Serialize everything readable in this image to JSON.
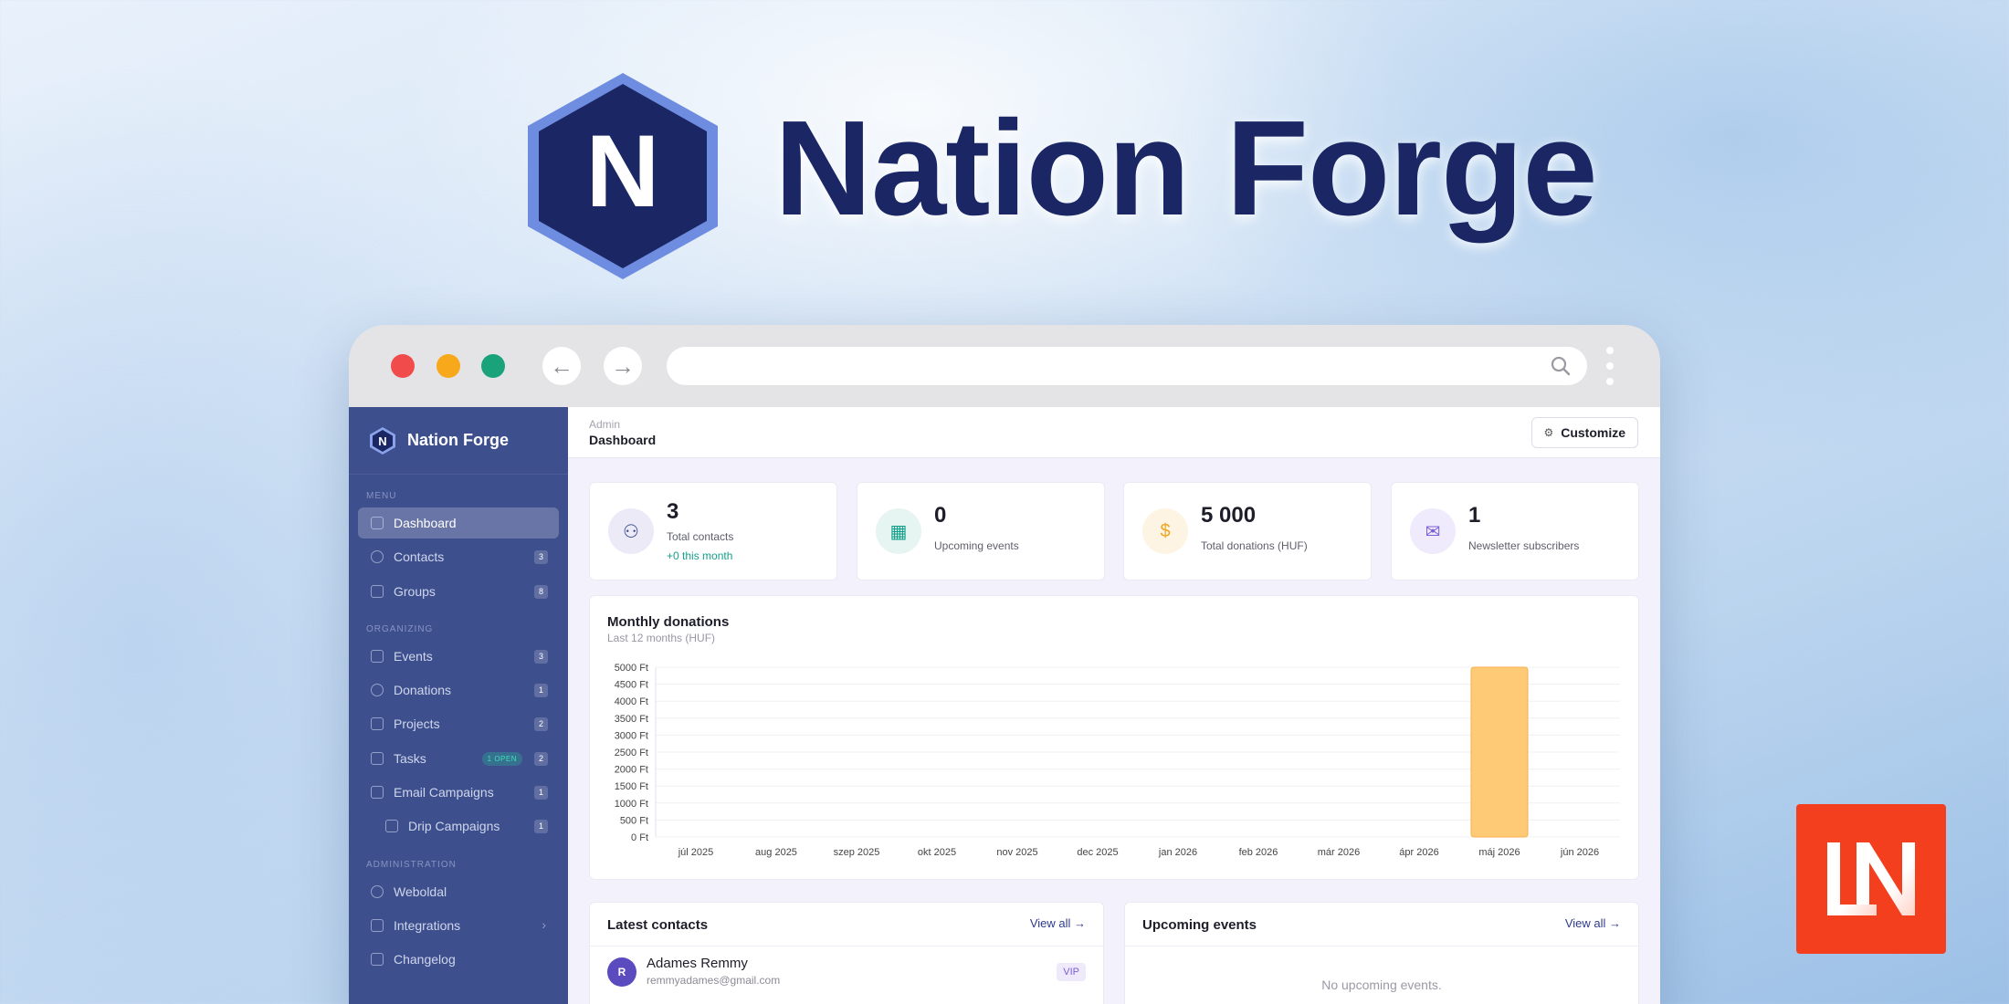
{
  "hero": {
    "title": "Nation Forge",
    "logo_letter": "N"
  },
  "browser": {
    "url": ""
  },
  "app": {
    "name": "Nation Forge",
    "logo_letter": "N"
  },
  "sidebar": {
    "sections": {
      "menu": "MENU",
      "organizing": "ORGANIZING",
      "administration": "ADMINISTRATION"
    },
    "items": [
      {
        "label": "Dashboard",
        "icon": "grid-icon",
        "active": true
      },
      {
        "label": "Contacts",
        "icon": "user-icon",
        "badge": "3"
      },
      {
        "label": "Groups",
        "icon": "group-icon",
        "badge": "8"
      },
      {
        "label": "Events",
        "icon": "calendar-icon",
        "badge": "3"
      },
      {
        "label": "Donations",
        "icon": "dollar-icon",
        "badge": "1"
      },
      {
        "label": "Projects",
        "icon": "folder-icon",
        "badge": "2"
      },
      {
        "label": "Tasks",
        "icon": "clipboard-icon",
        "pill": "1 OPEN",
        "badge": "2"
      },
      {
        "label": "Email Campaigns",
        "icon": "mail-icon",
        "badge": "1"
      },
      {
        "label": "Drip Campaigns",
        "icon": "drip-icon",
        "badge": "1"
      },
      {
        "label": "Weboldal",
        "icon": "globe-icon"
      },
      {
        "label": "Integrations",
        "icon": "puzzle-icon"
      },
      {
        "label": "Changelog",
        "icon": "list-icon"
      }
    ]
  },
  "header": {
    "breadcrumb": "Admin",
    "page_title": "Dashboard",
    "customize_label": "Customize"
  },
  "stats": [
    {
      "value": "3",
      "label": "Total contacts",
      "sub": "+0 this month",
      "icon": "user-icon",
      "color": "#3b4a8c"
    },
    {
      "value": "0",
      "label": "Upcoming events",
      "icon": "calendar-icon",
      "color": "#15a08b"
    },
    {
      "value": "5 000",
      "label": "Total donations (HUF)",
      "icon": "coin-icon",
      "color": "#f0a520"
    },
    {
      "value": "1",
      "label": "Newsletter subscribers",
      "icon": "mail-icon",
      "color": "#7a5fd6"
    }
  ],
  "chart_title": "Monthly donations",
  "chart_subtitle": "Last 12 months (HUF)",
  "chart_data": {
    "type": "bar",
    "categories": [
      "júl 2025",
      "aug 2025",
      "szep 2025",
      "okt 2025",
      "nov 2025",
      "dec 2025",
      "jan 2026",
      "feb 2026",
      "már 2026",
      "ápr 2026",
      "máj 2026",
      "jún 2026"
    ],
    "values": [
      0,
      0,
      0,
      0,
      0,
      0,
      0,
      0,
      0,
      0,
      5000,
      0
    ],
    "title": "Monthly donations",
    "subtitle": "Last 12 months (HUF)",
    "ylim": [
      0,
      5000
    ],
    "yticks": [
      "0 Ft",
      "500 Ft",
      "1000 Ft",
      "1500 Ft",
      "2000 Ft",
      "2500 Ft",
      "3000 Ft",
      "3500 Ft",
      "4000 Ft",
      "4500 Ft",
      "5000 Ft"
    ],
    "bar_color": "#ffca75",
    "grid": true
  },
  "latest_contacts": {
    "title": "Latest contacts",
    "view_all": "View all →",
    "rows": [
      {
        "initial": "R",
        "name": "Adames Remmy",
        "email": "remmyadames@gmail.com",
        "tag": "VIP"
      }
    ]
  },
  "upcoming_events": {
    "title": "Upcoming events",
    "view_all": "View all →",
    "empty": "No upcoming events."
  },
  "colors": {
    "sidebar": "#3e4f8e",
    "brand_dark": "#1b2764",
    "accent_teal": "#15a08b",
    "ln_badge": "#f33f1e"
  }
}
